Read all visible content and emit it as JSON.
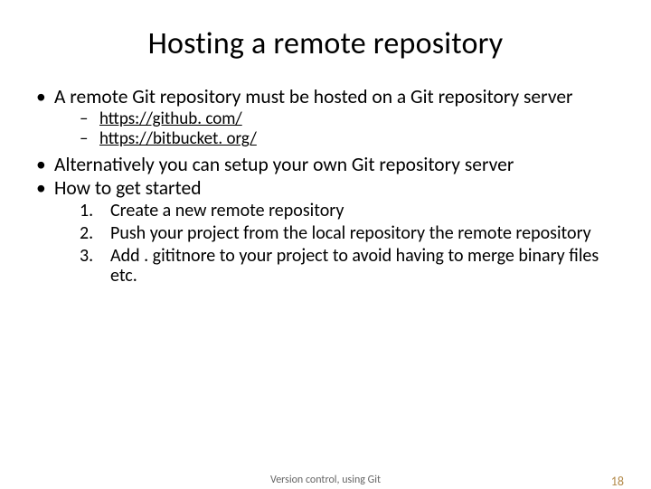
{
  "title": "Hosting a remote repository",
  "bullets": {
    "item1": "A remote Git repository must be hosted on a Git repository server",
    "link1": "https://github. com/",
    "link2": "https://bitbucket. org/",
    "item2": "Alternatively you can setup your own Git repository server",
    "item3": "How to get started",
    "step1": "Create a new remote repository",
    "step2": "Push your project from the local repository the remote repository",
    "step3": "Add . gititnore to your project to avoid having to merge binary files etc."
  },
  "footer": {
    "center": "Version control, using Git",
    "page": "18"
  }
}
